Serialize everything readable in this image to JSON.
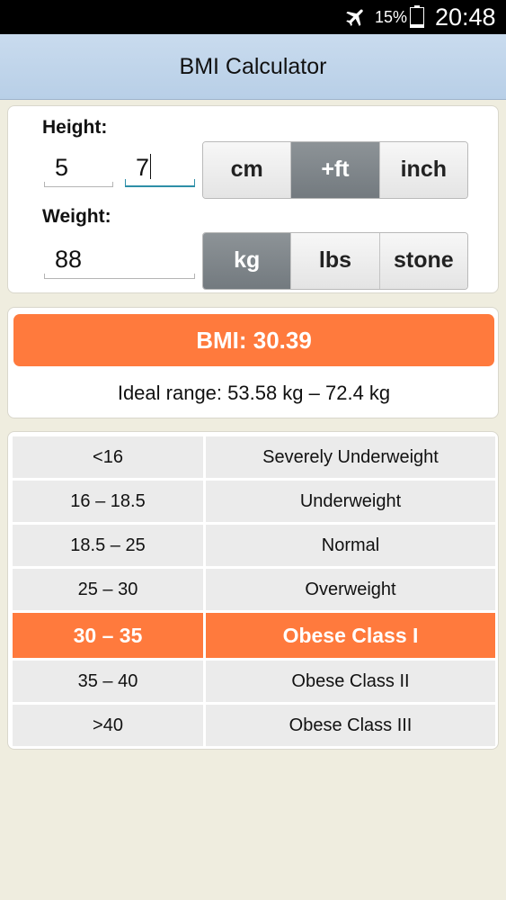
{
  "status_bar": {
    "airplane_icon": "airplane-icon",
    "battery_percent": "15%",
    "battery_icon": "battery-icon",
    "time": "20:48"
  },
  "app": {
    "title": "BMI Calculator"
  },
  "height": {
    "label": "Height:",
    "value_1": "5",
    "value_2": "7",
    "units": [
      "cm",
      "+ft",
      "inch"
    ],
    "selected_unit": "+ft"
  },
  "weight": {
    "label": "Weight:",
    "value": "88",
    "units": [
      "kg",
      "lbs",
      "stone"
    ],
    "selected_unit": "kg"
  },
  "result": {
    "bmi_text": "BMI: 30.39",
    "ideal_range": "Ideal range: 53.58 kg – 72.4 kg"
  },
  "categories": [
    {
      "range": "<16",
      "label": "Severely Underweight"
    },
    {
      "range": "16 – 18.5",
      "label": "Underweight"
    },
    {
      "range": "18.5 – 25",
      "label": "Normal"
    },
    {
      "range": "25 – 30",
      "label": "Overweight"
    },
    {
      "range": "30 – 35",
      "label": "Obese Class I"
    },
    {
      "range": "35 – 40",
      "label": "Obese Class II"
    },
    {
      "range": ">40",
      "label": "Obese Class III"
    }
  ],
  "highlighted_category": "Obese Class I",
  "colors": {
    "accent": "#ff7a3d",
    "focus": "#2e8fa8",
    "selected_segment": "#7f868b",
    "header": "#c3d7ec"
  }
}
